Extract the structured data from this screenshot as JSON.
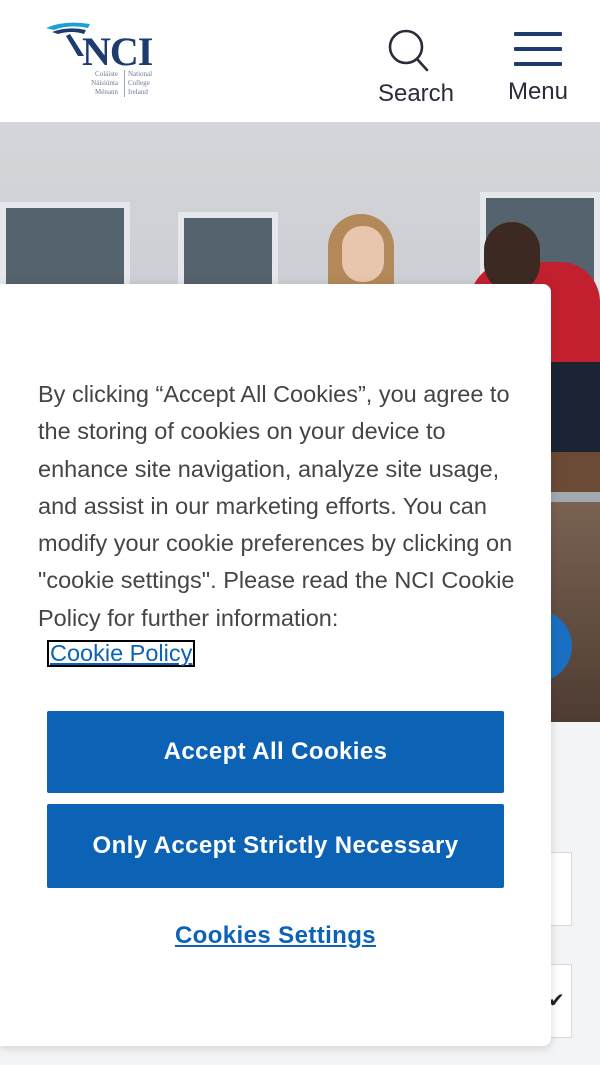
{
  "header": {
    "logo": {
      "name": "NCI",
      "sub_left": [
        "Coláiste",
        "Náisiúnta",
        "Ménann"
      ],
      "sub_right": [
        "National",
        "College",
        "Ireland"
      ]
    },
    "search_label": "Search",
    "menu_label": "Menu"
  },
  "cookie_banner": {
    "body_text": "By clicking “Accept All Cookies”, you agree to the storing of cookies on your device to enhance site navigation, analyze site usage, and assist in our marketing efforts. You can modify your cookie preferences by clicking on \"cookie settings\". Please read the NCI Cookie Policy for further information:",
    "policy_link": "Cookie Policy",
    "accept_all": "Accept All Cookies",
    "only_necessary": "Only Accept Strictly Necessary",
    "settings": "Cookies Settings"
  },
  "colors": {
    "brand_navy": "#1d3b6e",
    "button_blue": "#0c62b5",
    "link_blue": "#0d62b8"
  }
}
